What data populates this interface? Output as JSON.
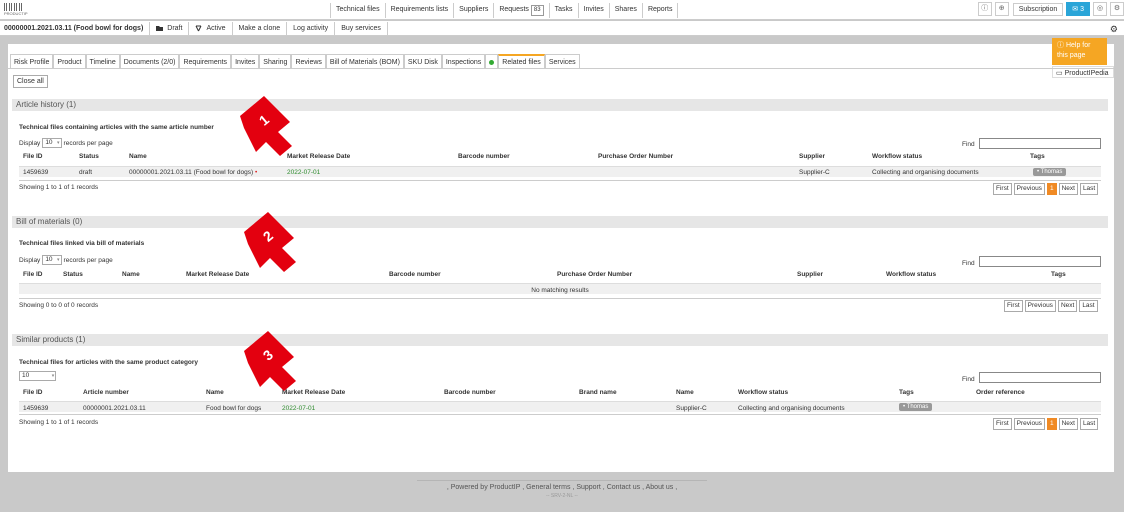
{
  "app": {
    "logo_text": "PRODUCTIP"
  },
  "nav": {
    "items": [
      "Technical files",
      "Requirements lists",
      "Suppliers",
      "Requests",
      "Tasks",
      "Invites",
      "Shares",
      "Reports"
    ],
    "requests_badge": "83",
    "subscription": "Subscription",
    "count_label": "3"
  },
  "record": {
    "title": "00000001.2021.03.11 (Food bowl for dogs)",
    "draft": "Draft",
    "active": "Active",
    "clone": "Make a clone",
    "log": "Log activity",
    "buy": "Buy services"
  },
  "help": {
    "label": "Help for this page",
    "productipedia": "ProductIPedia"
  },
  "tabs": [
    "Risk Profile",
    "Product",
    "Timeline",
    "Documents (2/0)",
    "Requirements",
    "Invites",
    "Sharing",
    "Reviews",
    "Bill of Materials (BOM)",
    "SKU Disk",
    "Inspections",
    "Related files",
    "Services"
  ],
  "close_all": "Close all",
  "display": {
    "prefix": "Display",
    "value": "10",
    "suffix": "records per page"
  },
  "find_label": "Find",
  "pagination": {
    "first": "First",
    "previous": "Previous",
    "page": "1",
    "next": "Next",
    "last": "Last"
  },
  "article_history": {
    "title": "Article history (1)",
    "subtitle": "Technical files containing articles with the same article number",
    "columns": [
      "File ID",
      "Status",
      "Name",
      "Market Release Date",
      "Barcode number",
      "Purchase Order Number",
      "Supplier",
      "Workflow status",
      "Tags"
    ],
    "row": {
      "file_id": "1459639",
      "status": "draft",
      "name": "00000001.2021.03.11 (Food bowl for dogs)",
      "mark": "•",
      "date": "2022-07-01",
      "supplier": "Supplier-C",
      "workflow": "Collecting and organising documents",
      "tag": "Thomas"
    },
    "showing": "Showing 1 to 1 of 1 records"
  },
  "bom": {
    "title": "Bill of materials (0)",
    "subtitle": "Technical files linked via bill of materials",
    "columns": [
      "File ID",
      "Status",
      "Name",
      "Market Release Date",
      "Barcode number",
      "Purchase Order Number",
      "Supplier",
      "Workflow status",
      "Tags"
    ],
    "empty": "No matching results",
    "showing": "Showing 0 to 0 of 0 records"
  },
  "similar": {
    "title": "Similar products (1)",
    "subtitle": "Technical files for articles with the same product category",
    "select_value": "10",
    "columns": [
      "File ID",
      "Article number",
      "Name",
      "Market Release Date",
      "Barcode number",
      "Brand name",
      "Name",
      "Workflow status",
      "Tags",
      "Order reference"
    ],
    "row": {
      "file_id": "1459639",
      "article": "00000001.2021.03.11",
      "name": "Food bowl for dogs",
      "date": "2022-07-01",
      "supplier": "Supplier-C",
      "workflow": "Collecting and organising documents",
      "tag": "Thomas"
    },
    "showing": "Showing 1 to 1 of 1 records"
  },
  "arrows": [
    "1",
    "2",
    "3"
  ],
  "colors": {
    "arrow": "#e3000f",
    "accent": "#f5a623",
    "count": "#2aa5d8",
    "date": "#2e8b2e"
  },
  "footer": {
    "powered": "Powered by ProductIP",
    "terms": "General terms",
    "support": "Support",
    "contact": "Contact us",
    "about": "About us",
    "server": "-- SRV-2-NL --"
  }
}
